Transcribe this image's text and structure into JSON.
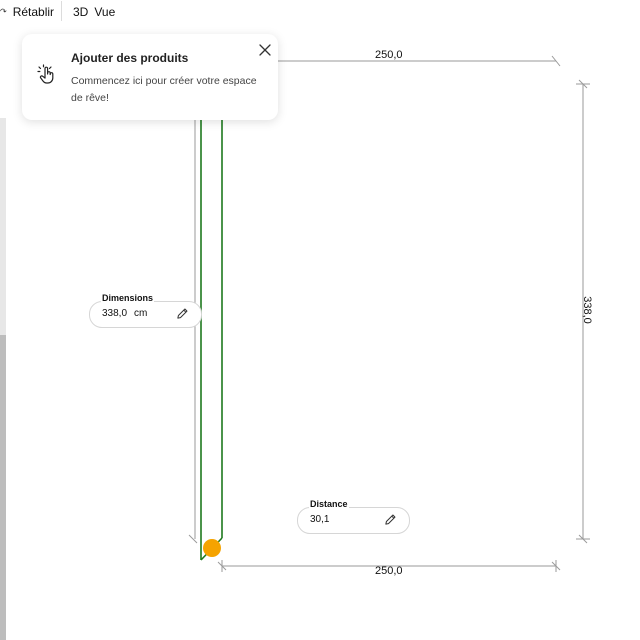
{
  "toolbar": {
    "undo_label": "Rétablir",
    "view_3d_label": "3D",
    "view_label": "Vue"
  },
  "popup": {
    "title": "Ajouter des produits",
    "text": "Commencez ici pour créer votre espace de rêve!",
    "icon": "hand-pointer-icon"
  },
  "dimensions_field": {
    "label": "Dimensions",
    "value": "338,0",
    "unit": "cm"
  },
  "distance_field": {
    "label": "Distance",
    "value": "30,1"
  },
  "measurements": {
    "top_width": "250,0",
    "bottom_width": "250,0",
    "right_height": "338,0"
  },
  "colors": {
    "wall_outline": "#1e7a1e",
    "handle": "#f5a300",
    "dimension_line": "#9a9a9a"
  }
}
